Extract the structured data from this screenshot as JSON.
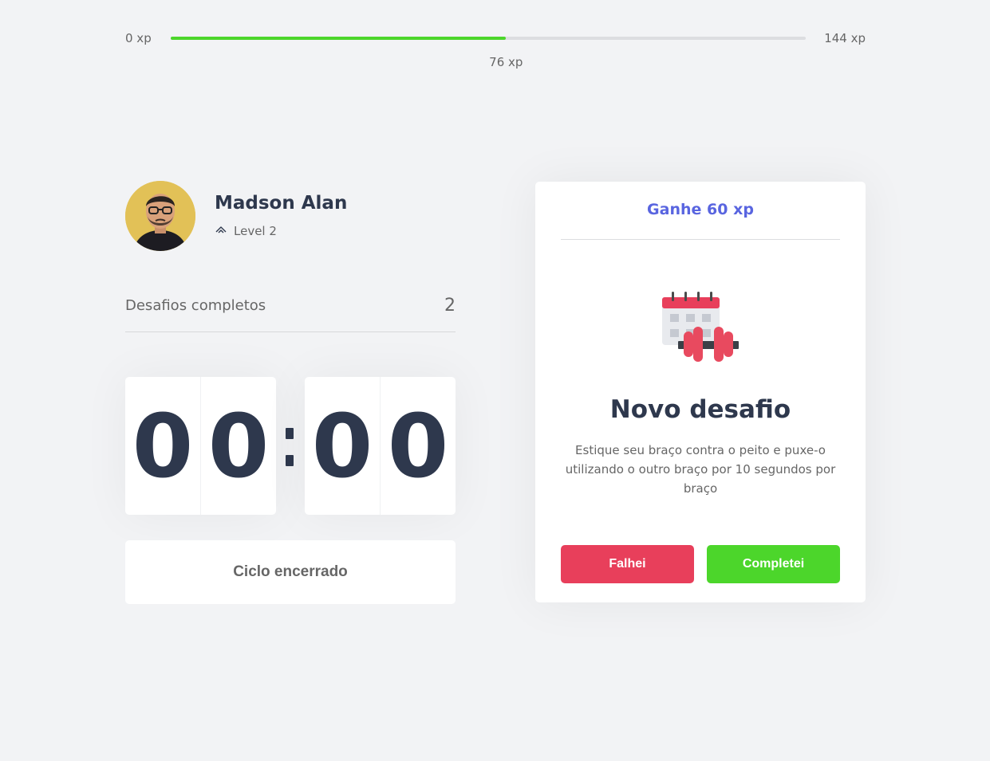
{
  "experience": {
    "min_label": "0 xp",
    "max_label": "144 xp",
    "current_label": "76 xp",
    "current": 76,
    "max": 144,
    "progress_fraction": 0.528,
    "bar_color": "#4cd62b"
  },
  "profile": {
    "name": "Madson Alan",
    "level_label": "Level 2",
    "level_icon": "level-up-icon"
  },
  "challenges": {
    "completed_label": "Desafios completos",
    "completed_count": "2"
  },
  "countdown": {
    "minute_left": "0",
    "minute_right": "0",
    "second_left": "0",
    "second_right": "0"
  },
  "cycle_button": {
    "label": "Ciclo encerrado"
  },
  "challenge_card": {
    "reward_label": "Ganhe 60 xp",
    "illustration": "body-exercise-icon",
    "title": "Novo desafio",
    "description": "Estique seu braço contra o peito e puxe-o utilizando o outro braço por 10 segundos por braço",
    "fail_label": "Falhei",
    "success_label": "Completei"
  },
  "colors": {
    "background": "#f2f3f5",
    "title": "#2e384d",
    "text": "#666666",
    "blue": "#5965e0",
    "red": "#e83f5b",
    "green": "#4cd62b"
  }
}
